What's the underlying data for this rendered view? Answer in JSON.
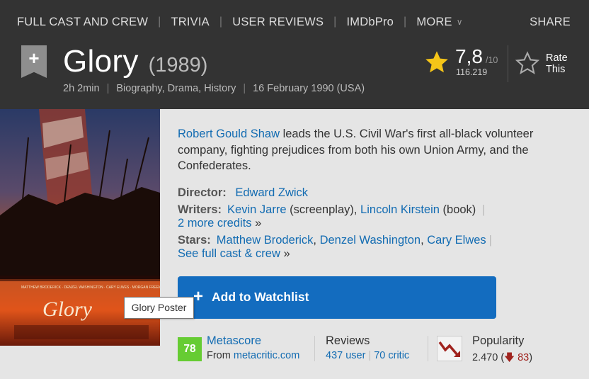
{
  "nav": {
    "full_cast": "FULL CAST AND CREW",
    "trivia": "TRIVIA",
    "user_reviews": "USER REVIEWS",
    "imdbpro": "IMDbPro",
    "more": "MORE",
    "share": "SHARE"
  },
  "title": {
    "name": "Glory",
    "year": "(1989)",
    "runtime": "2h 2min",
    "genres": "Biography, Drama, History",
    "release": "16 February 1990 (USA)"
  },
  "rating": {
    "value": "7,8",
    "max": "/10",
    "count": "116.219",
    "rate_label": "Rate This"
  },
  "poster": {
    "tooltip": "Glory Poster",
    "poster_title": "Glory"
  },
  "summary": {
    "link": "Robert Gould Shaw",
    "text": " leads the U.S. Civil War's first all-black volunteer company, fighting prejudices from both his own Union Army, and the Confederates."
  },
  "credits": {
    "director_label": "Director:",
    "director": "Edward Zwick",
    "writers_label": "Writers:",
    "writer1": "Kevin Jarre",
    "writer1_role": " (screenplay), ",
    "writer2": "Lincoln Kirstein",
    "writer2_role": " (book) ",
    "more_credits": "2 more credits",
    "stars_label": "Stars:",
    "star1": "Matthew Broderick",
    "star2": "Denzel Washington",
    "star3": "Cary Elwes",
    "full_cast": "See full cast & crew",
    "arrow": "»"
  },
  "watchlist": {
    "label": "Add to Watchlist"
  },
  "stats": {
    "metascore": "78",
    "metascore_label": "Metascore",
    "from": "From ",
    "metacritic": "metacritic.com",
    "reviews_label": "Reviews",
    "user_reviews": "437 user",
    "critic_reviews": "70 critic",
    "popularity_label": "Popularity",
    "popularity_value": "2.470",
    "popularity_change": "83"
  },
  "colors": {
    "header_bg": "#333333",
    "link": "#136cb2",
    "watchlist_bg": "#136cbf",
    "metascore_bg": "#66cc33",
    "star": "#f5c518"
  }
}
